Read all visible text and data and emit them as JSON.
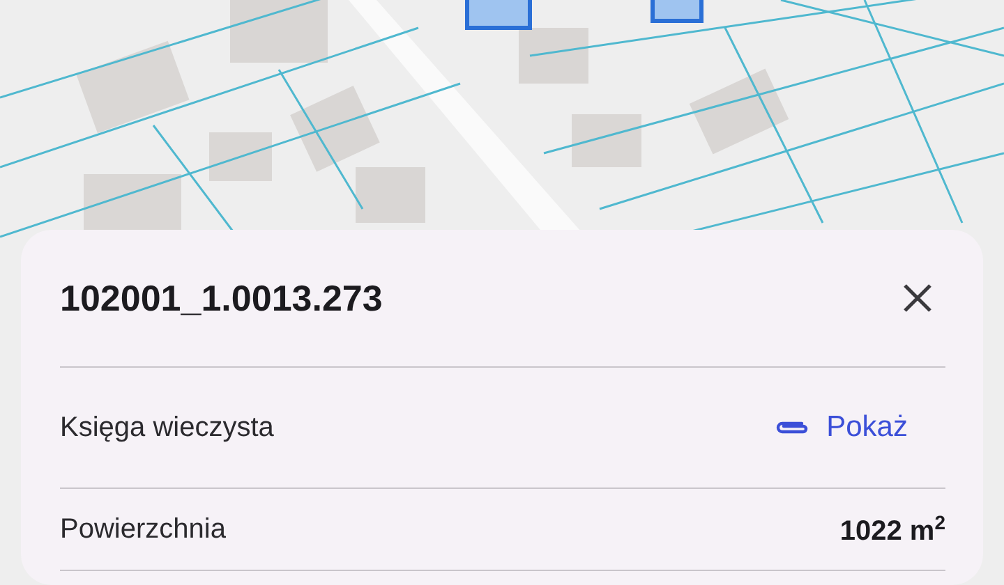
{
  "parcel_card": {
    "title": "102001_1.0013.273",
    "rows": [
      {
        "kind": "link",
        "label": "Księga wieczysta",
        "value": "Pokaż"
      },
      {
        "kind": "text",
        "label": "Powierzchnia",
        "value": "1022 m$^{2}$"
      }
    ]
  }
}
